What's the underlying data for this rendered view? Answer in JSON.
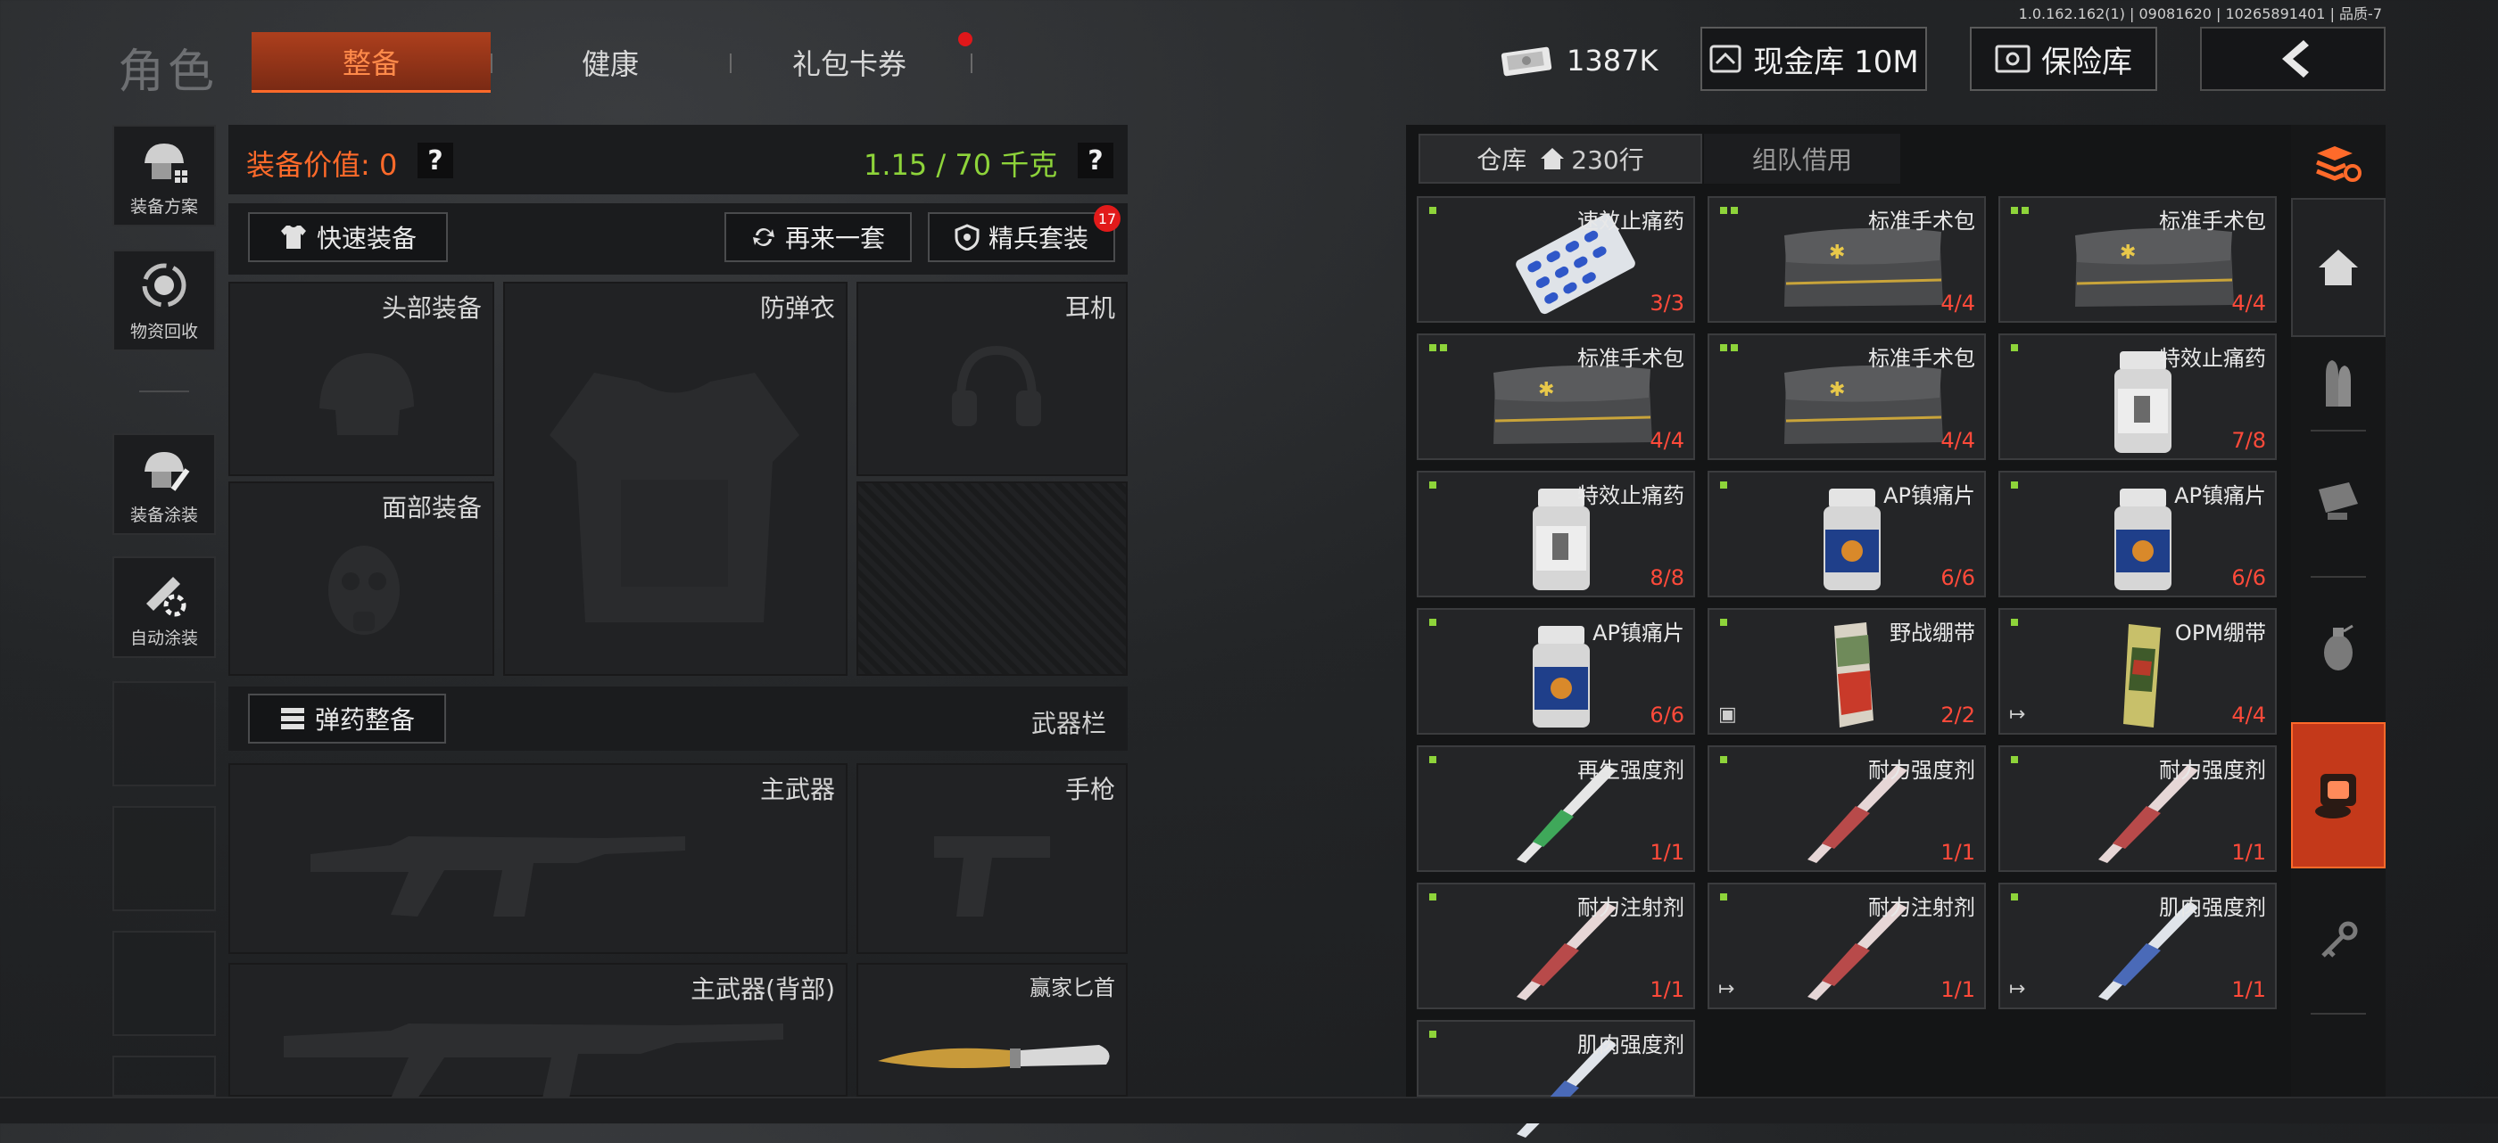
{
  "version": "1.0.162.162(1) | 09081620 | 10265891401 | 品质-7",
  "header": {
    "role_title": "角色",
    "tabs": [
      {
        "label": "整备",
        "active": true
      },
      {
        "label": "健康",
        "active": false
      },
      {
        "label": "礼包卡券",
        "active": false,
        "notify": true
      }
    ],
    "currency": "1387K",
    "cash_vault": "现金库 10M",
    "safe_box": "保险库"
  },
  "left_menu": [
    {
      "label": "装备方案",
      "icon": "loadout-icon"
    },
    {
      "label": "物资回收",
      "icon": "recycle-icon"
    },
    {
      "label": "装备涂装",
      "icon": "paint-icon"
    },
    {
      "label": "自动涂装",
      "icon": "auto-paint-icon"
    }
  ],
  "equipment": {
    "value_label": "装备价值: 0",
    "help": "?",
    "weight": "1.15 / 70 千克",
    "quick_equip": "快速装备",
    "again_set": "再来一套",
    "elite_set": "精兵套装",
    "elite_badge": "17",
    "slots": {
      "head": "头部装备",
      "armor": "防弹衣",
      "headset": "耳机",
      "face": "面部装备",
      "primary": "主武器",
      "pistol": "手枪",
      "primary_back": "主武器(背部)",
      "knife": "赢家匕首"
    },
    "ammo_btn": "弹药整备",
    "weapon_bar": "武器栏"
  },
  "storage": {
    "tab_warehouse": "仓库",
    "warehouse_rows": "230行",
    "tab_team": "组队借用",
    "items": [
      {
        "name": "速效止痛药",
        "count": "3/3",
        "kind": "pills",
        "marks": 1
      },
      {
        "name": "标准手术包",
        "count": "4/4",
        "kind": "bag",
        "marks": 2
      },
      {
        "name": "标准手术包",
        "count": "4/4",
        "kind": "bag",
        "marks": 2
      },
      {
        "name": "标准手术包",
        "count": "4/4",
        "kind": "bag",
        "marks": 2
      },
      {
        "name": "标准手术包",
        "count": "4/4",
        "kind": "bag",
        "marks": 2
      },
      {
        "name": "特效止痛药",
        "count": "7/8",
        "kind": "bottle",
        "marks": 1
      },
      {
        "name": "特效止痛药",
        "count": "8/8",
        "kind": "bottle",
        "marks": 1
      },
      {
        "name": "AP镇痛片",
        "count": "6/6",
        "kind": "bottle-blue",
        "marks": 1
      },
      {
        "name": "AP镇痛片",
        "count": "6/6",
        "kind": "bottle-blue",
        "marks": 1
      },
      {
        "name": "AP镇痛片",
        "count": "6/6",
        "kind": "bottle-blue",
        "marks": 1
      },
      {
        "name": "野战绷带",
        "count": "2/2",
        "kind": "bandage",
        "marks": 1,
        "corner": "box"
      },
      {
        "name": "OPM绷带",
        "count": "4/4",
        "kind": "bandage-green",
        "marks": 1,
        "corner": "exit"
      },
      {
        "name": "再生强度剂",
        "count": "1/1",
        "kind": "syringe-green",
        "marks": 1
      },
      {
        "name": "耐力强度剂",
        "count": "1/1",
        "kind": "syringe-red",
        "marks": 1
      },
      {
        "name": "耐力强度剂",
        "count": "1/1",
        "kind": "syringe-red",
        "marks": 1
      },
      {
        "name": "耐力注射剂",
        "count": "1/1",
        "kind": "syringe-red",
        "marks": 1
      },
      {
        "name": "耐力注射剂",
        "count": "1/1",
        "kind": "syringe-red",
        "marks": 1,
        "corner": "exit"
      },
      {
        "name": "肌肉强度剂",
        "count": "1/1",
        "kind": "syringe-blue",
        "marks": 1,
        "corner": "exit"
      },
      {
        "name": "肌肉强度剂",
        "count": "",
        "kind": "syringe-blue",
        "marks": 1
      }
    ]
  },
  "right_categories": [
    "sort-icon",
    "home-icon",
    "ammo-icon",
    "scope-icon",
    "grenade-icon",
    "medical-icon",
    "key-icon"
  ],
  "colors": {
    "accent": "#ff6a2a",
    "weight": "#8ed43a",
    "count": "#ff4a3a"
  }
}
